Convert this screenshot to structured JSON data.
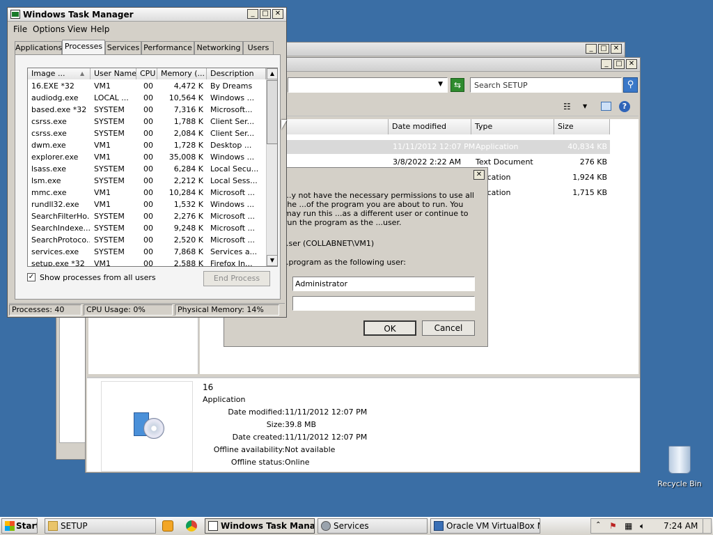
{
  "taskmgr": {
    "title": "Windows Task Manager",
    "menu": [
      "File",
      "Options",
      "View",
      "Help"
    ],
    "tabs": [
      "Applications",
      "Processes",
      "Services",
      "Performance",
      "Networking",
      "Users"
    ],
    "columns": [
      "Image ...",
      "User Name",
      "CPU",
      "Memory (...",
      "Description"
    ],
    "rows": [
      [
        "16.EXE *32",
        "VM1",
        "00",
        "4,472 K",
        "By Dreams"
      ],
      [
        "audiodg.exe",
        "LOCAL ...",
        "00",
        "10,564 K",
        "Windows ..."
      ],
      [
        "based.exe *32",
        "SYSTEM",
        "00",
        "7,316 K",
        "Microsoft..."
      ],
      [
        "csrss.exe",
        "SYSTEM",
        "00",
        "1,788 K",
        "Client Ser..."
      ],
      [
        "csrss.exe",
        "SYSTEM",
        "00",
        "2,084 K",
        "Client Ser..."
      ],
      [
        "dwm.exe",
        "VM1",
        "00",
        "1,728 K",
        "Desktop ..."
      ],
      [
        "explorer.exe",
        "VM1",
        "00",
        "35,008 K",
        "Windows ..."
      ],
      [
        "lsass.exe",
        "SYSTEM",
        "00",
        "6,284 K",
        "Local Secu..."
      ],
      [
        "lsm.exe",
        "SYSTEM",
        "00",
        "2,212 K",
        "Local Sess..."
      ],
      [
        "mmc.exe",
        "VM1",
        "00",
        "10,284 K",
        "Microsoft ..."
      ],
      [
        "rundll32.exe",
        "VM1",
        "00",
        "1,532 K",
        "Windows ..."
      ],
      [
        "SearchFilterHo...",
        "SYSTEM",
        "00",
        "2,276 K",
        "Microsoft ..."
      ],
      [
        "SearchIndexe...",
        "SYSTEM",
        "00",
        "9,248 K",
        "Microsoft ..."
      ],
      [
        "SearchProtoco...",
        "SYSTEM",
        "00",
        "2,520 K",
        "Microsoft ..."
      ],
      [
        "services.exe",
        "SYSTEM",
        "00",
        "7,868 K",
        "Services a..."
      ],
      [
        "setup.exe *32",
        "VM1",
        "00",
        "2,588 K",
        "Firefox In..."
      ]
    ],
    "show_all_label": "Show processes from all users",
    "end_process": "End Process",
    "status": {
      "processes": "Processes: 40",
      "cpu": "CPU Usage: 0%",
      "memory": "Physical Memory: 14%"
    }
  },
  "explorer": {
    "search_placeholder": "Search SETUP",
    "columns": [
      "Date modified",
      "Type",
      "Size"
    ],
    "files": [
      {
        "date": "11/11/2012 12:07 PM",
        "type": "Application",
        "size": "40,834 KB"
      },
      {
        "date": "3/8/2022 2:22 AM",
        "type": "Text Document",
        "size": "276 KB"
      },
      {
        "date": "",
        "type": "...lication",
        "size": "1,924 KB"
      },
      {
        "date": "",
        "type": "...lication",
        "size": "1,715 KB"
      }
    ],
    "details": {
      "name": "16",
      "kind": "Application",
      "labels": [
        "Date modified:",
        "Size:",
        "Date created:",
        "Offline availability:",
        "Offline status:"
      ],
      "values": [
        "11/11/2012 12:07 PM",
        "39.8 MB",
        "11/11/2012 12:07 PM",
        "Not available",
        "Online"
      ]
    }
  },
  "runas": {
    "text": "...y not have the necessary permissions to use all the ...of the program you are about to run. You may run this ...as a different user or continue to run the program as the ...user.",
    "current_user": "...ser (COLLABNET\\VM1)",
    "following_user": "...program as the following user:",
    "username": "Administrator",
    "password": "",
    "ok": "OK",
    "cancel": "Cancel"
  },
  "desktop": {
    "recycle_bin": "Recycle Bin"
  },
  "taskbar": {
    "start": "Start",
    "items": [
      "SETUP",
      "Windows Task Manag...",
      "Services",
      "Oracle VM VirtualBox Ma..."
    ],
    "clock": "7:24 AM"
  }
}
